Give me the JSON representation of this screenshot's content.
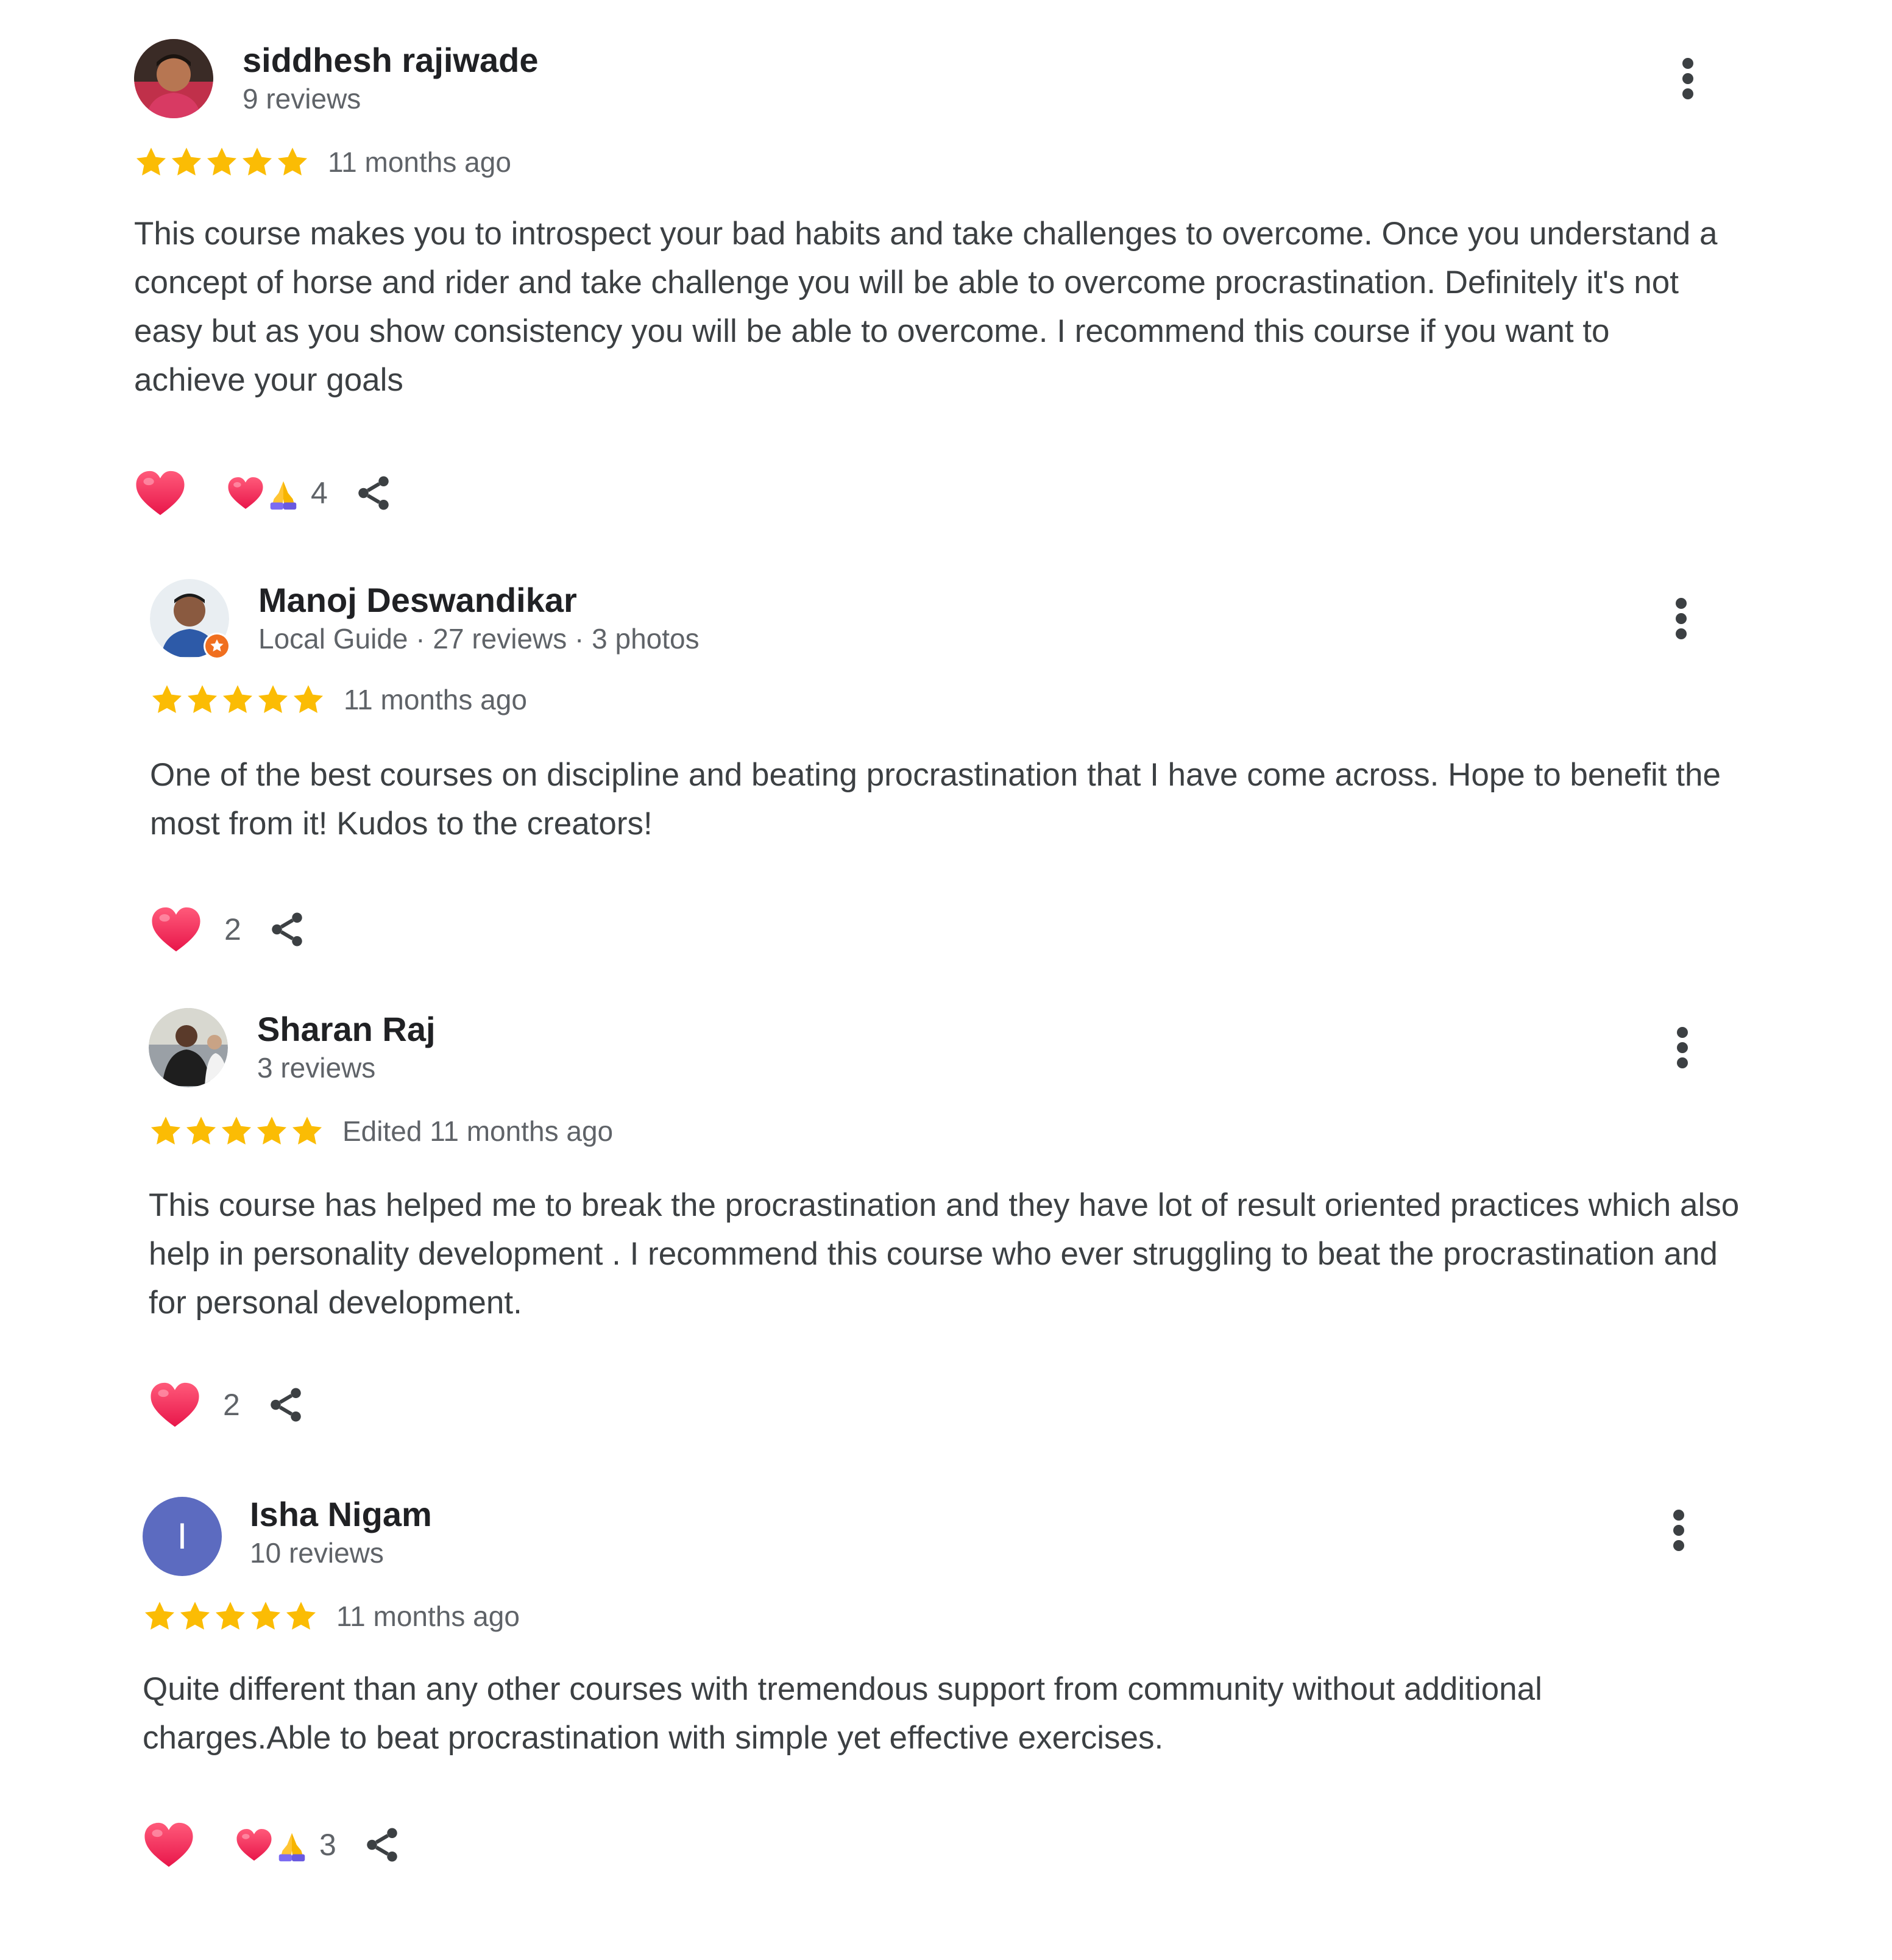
{
  "reviews": [
    {
      "name": "siddhesh rajiwade",
      "meta": "9 reviews",
      "avatar": "photo",
      "rating": 5,
      "date": "11 months ago",
      "text": "This course makes you to introspect your bad habits and take challenges to overcome. Once you understand a concept of horse and rider and take challenge you will be able to overcome procrastination. Definitely it's not easy but as you show consistency you will be able to overcome. I recommend this course if you want to achieve your goals",
      "reactions": [
        "heart-icon",
        "folded-hands-icon"
      ],
      "reaction_count": "4"
    },
    {
      "name": "Manoj Deswandikar",
      "meta": "Local Guide · 27 reviews · 3 photos",
      "avatar": "photo",
      "local_guide": true,
      "rating": 5,
      "date": "11 months ago",
      "text": "One of the best courses on discipline and beating procrastination that I have come across. Hope to benefit the most from it! Kudos to the creators!",
      "reactions": [],
      "reaction_count": "2"
    },
    {
      "name": "Sharan Raj",
      "meta": "3 reviews",
      "avatar": "photo",
      "rating": 5,
      "date": "Edited 11 months ago",
      "text": "This course has helped me to break the procrastination and they have lot of result oriented practices which also help in personality development . I recommend this course who ever struggling to beat the procrastination and for personal development.",
      "reactions": [],
      "reaction_count": "2"
    },
    {
      "name": "Isha Nigam",
      "meta": "10 reviews",
      "avatar": "letter",
      "avatar_letter": "I",
      "rating": 5,
      "date": "11 months ago",
      "text": "Quite different than any other courses with tremendous support from community without additional charges.Able to beat procrastination with simple yet effective exercises.",
      "reactions": [
        "heart-icon",
        "folded-hands-icon"
      ],
      "reaction_count": "3"
    }
  ],
  "icons": {
    "more": "more-vert-icon",
    "like": "heart-icon",
    "share": "share-icon",
    "star": "star-icon"
  },
  "colors": {
    "star": "#fbbc04",
    "heart": "#f0325a",
    "letter_avatar": "#5c6bc0",
    "local_guide_badge": "#f06f1f"
  }
}
